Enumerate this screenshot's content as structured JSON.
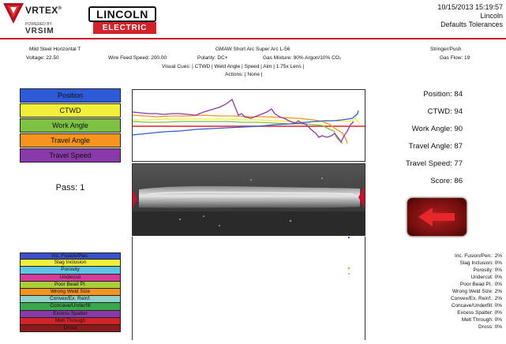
{
  "header": {
    "vrtex_label": "VRTEX",
    "registered": "®",
    "powered_by": "POWERED BY",
    "vrsim_label": "VRSIM",
    "brand_top": "LINCOLN",
    "brand_bottom": "ELECTRIC",
    "datetime": "10/15/2013 15:19:57",
    "user": "Lincoln",
    "profile": "Defaults Tolerances"
  },
  "info": {
    "joint": "Mild Steel Horizontal T",
    "process": "GMAW Short Arc Super Arc L-56",
    "technique": "Stringer/Push",
    "voltage": "Voltage: 22.50",
    "wire_feed": "Wire Feed Speed: 200.00",
    "polarity": "Polarity: DC+",
    "gas_mixture": "Gas Mixture: 90% Argon/10% CO₂",
    "gas_flow": "Gas Flow: 19",
    "visual_cues": "Visual Cues:  | CTWD | Weld Angle  | Speed  | Aim  | 1.75x Lens |",
    "actions": "Actions:  | None |"
  },
  "legend": [
    {
      "label": "Position",
      "color": "#2d5bd8"
    },
    {
      "label": "CTWD",
      "color": "#f2ef3a"
    },
    {
      "label": "Work Angle",
      "color": "#7dc242"
    },
    {
      "label": "Travel Angle",
      "color": "#f7941d"
    },
    {
      "label": "Travel Speed",
      "color": "#8a3aa8"
    }
  ],
  "pass_label": "Pass: 1",
  "stats": {
    "position": "Position: 84",
    "ctwd": "CTWD: 94",
    "work_angle": "Work Angle: 90",
    "travel_angle": "Travel Angle: 87",
    "travel_speed": "Travel Speed: 77",
    "score": "Score: 86"
  },
  "defects": [
    {
      "label": "Inc. Fusion/Pen.",
      "color": "#3a4fc8",
      "pct": "Inc. Fusion/Pen.: 2%"
    },
    {
      "label": "Slag Inclusion",
      "color": "#f2ef3a",
      "pct": "Slag Inclusion: 0%"
    },
    {
      "label": "Porosity",
      "color": "#5fc3e4",
      "pct": "Porosity: 0%"
    },
    {
      "label": "Undercut",
      "color": "#d63a9b",
      "pct": "Undercut: 0%"
    },
    {
      "label": "Poor Bead Pl.",
      "color": "#a8cf3a",
      "pct": "Poor Bead Pl.: 0%"
    },
    {
      "label": "Wrong Weld Size",
      "color": "#f7941d",
      "pct": "Wrong Weld Size: 2%"
    },
    {
      "label": "Convex/Ex. Reinf.",
      "color": "#8fd0c8",
      "pct": "Convex/Ex. Reinf.: 2%"
    },
    {
      "label": "Concave/Underfill",
      "color": "#3aa84a",
      "pct": "Concave/Underfill: 0%"
    },
    {
      "label": "Excess Spatter",
      "color": "#8a3aa8",
      "pct": "Excess Spatter: 0%"
    },
    {
      "label": "Melt Through",
      "color": "#d2232a",
      "pct": "Melt Through: 0%"
    },
    {
      "label": "Dross",
      "color": "#8b1a1a",
      "pct": "Dross: 0%"
    }
  ],
  "colors": {
    "accent": "#c8102e",
    "tolerance_line": "#e0202a"
  },
  "icons": {
    "back_arrow": "left-arrow-icon"
  }
}
